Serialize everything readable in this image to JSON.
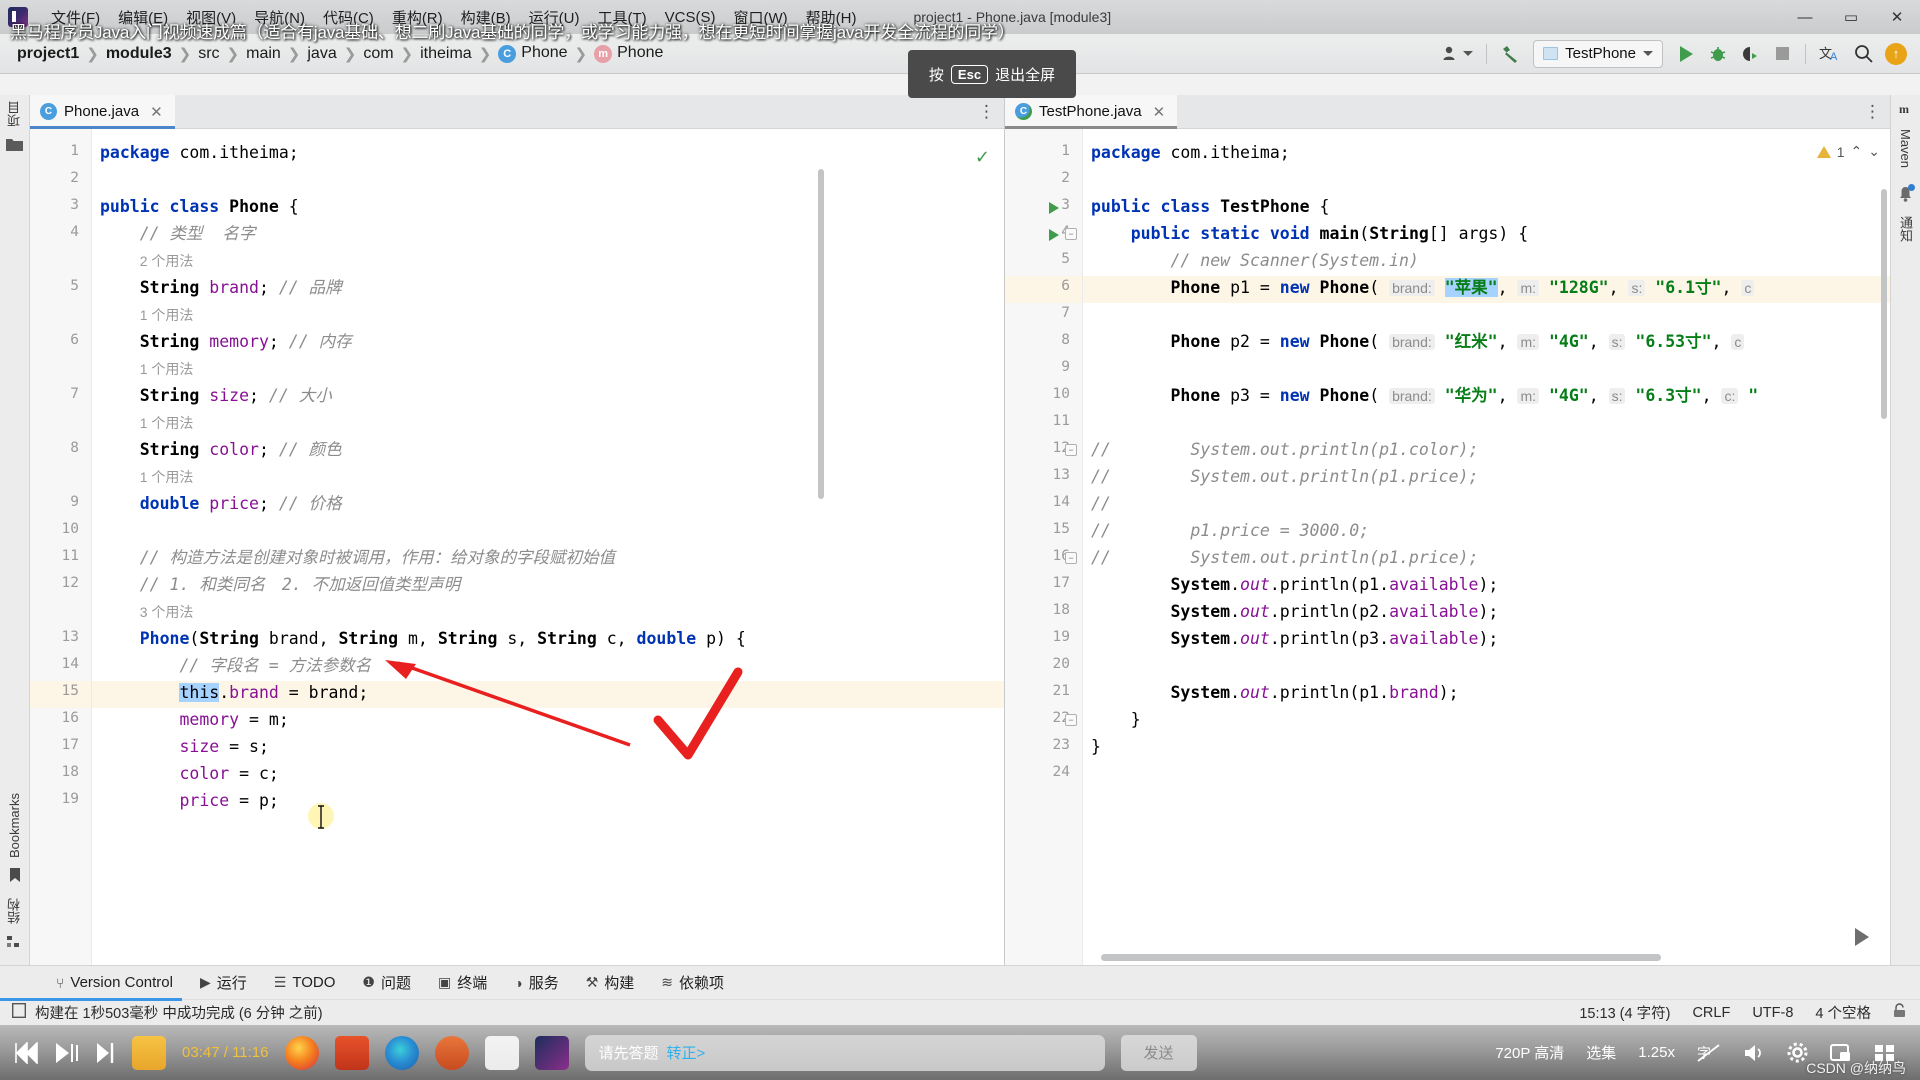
{
  "app": {
    "window_title": "project1 - Phone.java [module3]",
    "logo_name": "intellij-idea-logo"
  },
  "menubar": {
    "items": [
      "文件(F)",
      "编辑(E)",
      "视图(V)",
      "导航(N)",
      "代码(C)",
      "重构(R)",
      "构建(B)",
      "运行(U)",
      "工具(T)",
      "VCS(S)",
      "窗口(W)",
      "帮助(H)"
    ],
    "window_controls": {
      "minimize": "—",
      "maximize": "▭",
      "close": "✕"
    }
  },
  "video_overlay": {
    "subtitle": "黑马程序员Java入门视频速成篇（适合有java基础、想二刷Java基础的同学，或学习能力强，想在更短时间掌握java开发全流程的同学）",
    "esc_tip_prefix": "按",
    "esc_key": "Esc",
    "esc_tip_suffix": "退出全屏"
  },
  "breadcrumb": {
    "items": [
      {
        "label": "project1",
        "bold": true,
        "icon": ""
      },
      {
        "label": "module3",
        "bold": true,
        "icon": ""
      },
      {
        "label": "src",
        "bold": false,
        "icon": ""
      },
      {
        "label": "main",
        "bold": false,
        "icon": ""
      },
      {
        "label": "java",
        "bold": false,
        "icon": ""
      },
      {
        "label": "com",
        "bold": false,
        "icon": ""
      },
      {
        "label": "itheima",
        "bold": false,
        "icon": ""
      },
      {
        "label": "Phone",
        "bold": false,
        "icon": "class-icon"
      },
      {
        "label": "Phone",
        "bold": false,
        "icon": "method-icon"
      }
    ],
    "separator": "❯"
  },
  "toolbar": {
    "settings_icon": "user-settings-icon",
    "build_icon": "hammer-icon",
    "run_config": "TestPhone",
    "run_icon": "run-icon",
    "debug_icon": "debug-icon",
    "coverage_icon": "run-with-coverage-icon",
    "stop_icon": "stop-icon",
    "translate_icon": "translate-icon",
    "search_icon": "search-icon",
    "update_icon": "update-available-icon"
  },
  "tool_strips": {
    "left": [
      {
        "label": "项目",
        "icon": "project-icon"
      },
      {
        "label": "",
        "icon": "folder-icon"
      },
      {
        "label": "Bookmarks",
        "icon": "bookmark-icon"
      },
      {
        "label": "结构",
        "icon": "structure-icon"
      }
    ],
    "right": [
      {
        "label": "Maven",
        "icon": "maven-icon"
      },
      {
        "label": "通知",
        "icon": "notifications-bell-icon"
      }
    ]
  },
  "left_editor": {
    "tab": {
      "label": "Phone.java",
      "icon": "java-class-icon",
      "close": "✕"
    },
    "inspection_status": "✓",
    "overflow_menu": "⋮",
    "lines": [
      {
        "n": "1",
        "html": "<span class='kw'>package</span> com.itheima;"
      },
      {
        "n": "2",
        "html": ""
      },
      {
        "n": "3",
        "html": "<span class='kw'>public class</span> <span class='ty'>Phone</span> {"
      },
      {
        "n": "4",
        "html": "    <span class='cm'>// 类型  名字</span>"
      },
      {
        "n": "",
        "html": "    <span class='hint'>2 个用法</span>",
        "hintline": true
      },
      {
        "n": "5",
        "html": "    <span class='ty'>String</span> <span class='fld'>brand</span>; <span class='cm'>// 品牌</span>"
      },
      {
        "n": "",
        "html": "    <span class='hint'>1 个用法</span>",
        "hintline": true
      },
      {
        "n": "6",
        "html": "    <span class='ty'>String</span> <span class='fld'>memory</span>; <span class='cm'>// 内存</span>"
      },
      {
        "n": "",
        "html": "    <span class='hint'>1 个用法</span>",
        "hintline": true
      },
      {
        "n": "7",
        "html": "    <span class='ty'>String</span> <span class='fld'>size</span>; <span class='cm'>// 大小</span>"
      },
      {
        "n": "",
        "html": "    <span class='hint'>1 个用法</span>",
        "hintline": true
      },
      {
        "n": "8",
        "html": "    <span class='ty'>String</span> <span class='fld'>color</span>; <span class='cm'>// 颜色</span>"
      },
      {
        "n": "",
        "html": "    <span class='hint'>1 个用法</span>",
        "hintline": true
      },
      {
        "n": "9",
        "html": "    <span class='kw'>double</span> <span class='fld'>price</span>; <span class='cm'>// 价格</span>"
      },
      {
        "n": "10",
        "html": ""
      },
      {
        "n": "11",
        "html": "    <span class='cm'>// 构造方法是创建对象时被调用，作用：给对象的字段赋初始值</span>"
      },
      {
        "n": "12",
        "html": "    <span class='cm'>// 1. 和类同名　2. 不加返回值类型声明</span>"
      },
      {
        "n": "",
        "html": "    <span class='hint'>3 个用法</span>",
        "hintline": true
      },
      {
        "n": "13",
        "html": "    <span class='ty' style='color:#0033b3'>Phone</span>(<span class='ty'>String</span> brand, <span class='ty'>String</span> m, <span class='ty'>String</span> s, <span class='ty'>String</span> c, <span class='kw'>double</span> p) {"
      },
      {
        "n": "14",
        "html": "        <span class='cm'>// 字段名 = 方法参数名</span>"
      },
      {
        "n": "15",
        "html": "        <span class='sel'>this</span>.<span class='fld'>brand</span> = brand;",
        "current": true
      },
      {
        "n": "16",
        "html": "        <span class='fld'>memory</span> = m;"
      },
      {
        "n": "17",
        "html": "        <span class='fld'>size</span> = s;"
      },
      {
        "n": "18",
        "html": "        <span class='fld'>color</span> = c;"
      },
      {
        "n": "19",
        "html": "        <span class='fld'>price</span> = p;"
      }
    ]
  },
  "right_editor": {
    "tab": {
      "label": "TestPhone.java",
      "icon": "java-class-icon",
      "close": "✕"
    },
    "warning_count": "1",
    "warning_up": "⌃",
    "warning_down": "⌄",
    "lines": [
      {
        "n": "1",
        "html": "<span class='kw'>package</span> com.itheima;"
      },
      {
        "n": "2",
        "html": ""
      },
      {
        "n": "3",
        "html": "<span class='kw'>public class</span> <span class='ty'>TestPhone</span> {",
        "run": true
      },
      {
        "n": "4",
        "html": "    <span class='kw'>public static</span> <span class='kw'>void</span> <span class='ty'>main</span>(<span class='ty'>String</span>[] args) {",
        "run": true,
        "fold": true
      },
      {
        "n": "5",
        "html": "        <span class='cm'>// new Scanner(System.in)</span>"
      },
      {
        "n": "6",
        "html": "        <span class='ty'>Phone</span> p1 = <span class='kw'>new</span> <span class='ty'>Phone</span>( <span class='pname'>brand:</span> <span class='str sel'>\"苹果\"</span>, <span class='pname'>m:</span> <span class='str'>\"128G\"</span>, <span class='pname'>s:</span> <span class='str'>\"6.1寸\"</span>, <span class='pname'>c</span>",
        "current": true
      },
      {
        "n": "7",
        "html": ""
      },
      {
        "n": "8",
        "html": "        <span class='ty'>Phone</span> p2 = <span class='kw'>new</span> <span class='ty'>Phone</span>( <span class='pname'>brand:</span> <span class='str'>\"红米\"</span>, <span class='pname'>m:</span> <span class='str'>\"4G\"</span>, <span class='pname'>s:</span> <span class='str'>\"6.53寸\"</span>, <span class='pname'>c</span>"
      },
      {
        "n": "9",
        "html": ""
      },
      {
        "n": "10",
        "html": "        <span class='ty'>Phone</span> p3 = <span class='kw'>new</span> <span class='ty'>Phone</span>( <span class='pname'>brand:</span> <span class='str'>\"华为\"</span>, <span class='pname'>m:</span> <span class='str'>\"4G\"</span>, <span class='pname'>s:</span> <span class='str'>\"6.3寸\"</span>, <span class='pname'>c:</span> <span class='str'>\"</span>"
      },
      {
        "n": "11",
        "html": ""
      },
      {
        "n": "12",
        "html": "<span class='cm'>//        System.out.println(p1.color);</span>",
        "fold": true
      },
      {
        "n": "13",
        "html": "<span class='cm'>//        System.out.println(p1.price);</span>"
      },
      {
        "n": "14",
        "html": "<span class='cm'>//</span>"
      },
      {
        "n": "15",
        "html": "<span class='cm'>//        p1.price = 3000.0;</span>"
      },
      {
        "n": "16",
        "html": "<span class='cm'>//        System.out.println(p1.price);</span>",
        "fold": true
      },
      {
        "n": "17",
        "html": "        <span class='ty'>System</span>.<span class='fld' style='font-style:italic'>out</span>.println(p1.<span class='fld'>available</span>);"
      },
      {
        "n": "18",
        "html": "        <span class='ty'>System</span>.<span class='fld' style='font-style:italic'>out</span>.println(p2.<span class='fld'>available</span>);"
      },
      {
        "n": "19",
        "html": "        <span class='ty'>System</span>.<span class='fld' style='font-style:italic'>out</span>.println(p3.<span class='fld'>available</span>);"
      },
      {
        "n": "20",
        "html": ""
      },
      {
        "n": "21",
        "html": "        <span class='ty'>System</span>.<span class='fld' style='font-style:italic'>out</span>.println(p1.<span class='fld'>brand</span>);"
      },
      {
        "n": "22",
        "html": "    }",
        "fold": true
      },
      {
        "n": "23",
        "html": "}"
      },
      {
        "n": "24",
        "html": ""
      }
    ]
  },
  "bottom_toolwindows": [
    {
      "label": "Version Control",
      "icon": "branch-icon"
    },
    {
      "label": "运行",
      "icon": "run-icon"
    },
    {
      "label": "TODO",
      "icon": "todo-list-icon"
    },
    {
      "label": "问题",
      "icon": "problems-icon"
    },
    {
      "label": "终端",
      "icon": "terminal-icon"
    },
    {
      "label": "服务",
      "icon": "services-icon"
    },
    {
      "label": "构建",
      "icon": "hammer-icon"
    },
    {
      "label": "依赖项",
      "icon": "dependencies-icon"
    }
  ],
  "statusbar": {
    "build_icon": "build-status-icon",
    "message": "构建在 1秒503毫秒 中成功完成 (6 分钟 之前)",
    "caret_position": "15:13 (4 字符)",
    "line_separator": "CRLF",
    "encoding": "UTF-8",
    "indent": "4 个空格",
    "lock_icon": "lock-icon"
  },
  "player": {
    "prev_icon": "previous-track-icon",
    "play_icon": "play-icon",
    "next_icon": "next-track-icon",
    "time_current": "03:47",
    "time_separator": "/",
    "time_total": "11:16",
    "taskbar_icons": [
      "file-explorer-icon",
      "firefox-icon",
      "office-icon",
      "edge-icon",
      "powerpoint-icon",
      "screen-record-icon",
      "intellij-idea-icon"
    ],
    "chat_placeholder": "请先答题",
    "chat_link": "转正>",
    "send_label": "发送",
    "quality": "720P 高清",
    "episodes": "选集",
    "speed": "1.25x",
    "subtitle_icon": "subtitles-off-icon",
    "volume_icon": "volume-icon",
    "settings_icon": "gear-icon",
    "pip_icon": "picture-in-picture-icon",
    "fullscreen_icon": "exit-fullscreen-icon",
    "watermark": "CSDN @纳纳鸟",
    "play_overlay_icon": "play-overlay-icon"
  },
  "colors": {
    "accent_blue": "#4a86c8",
    "keyword": "#0033b3",
    "string": "#067d17",
    "field": "#871094",
    "comment": "#8c8c8c",
    "selection": "#a6d2ff",
    "current_line": "#fdf5e6",
    "annotation_red": "#e8201f"
  }
}
